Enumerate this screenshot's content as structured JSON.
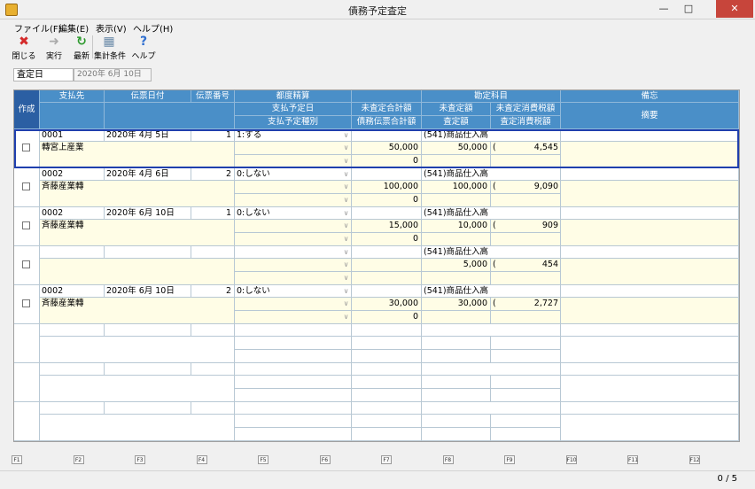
{
  "window": {
    "title": "債務予定査定",
    "min": "—",
    "max": "□",
    "close": "✕"
  },
  "menu": [
    "ファイル(F)",
    "編集(E)",
    "表示(V)",
    "ヘルプ(H)"
  ],
  "toolbar": [
    {
      "name": "close",
      "label": "閉じる",
      "icon": "✖",
      "color": "#d42a2a"
    },
    {
      "name": "run",
      "label": "実行",
      "icon": "➜",
      "color": "#aaaaaa"
    },
    {
      "name": "refresh",
      "label": "最新",
      "icon": "↻",
      "color": "#2e9a2e"
    },
    {
      "name": "conditions",
      "label": "集計条件",
      "icon": "▦",
      "color": "#6a8aa8"
    },
    {
      "name": "help",
      "label": "ヘルプ",
      "icon": "?",
      "color": "#2f6fd0"
    }
  ],
  "filter": {
    "label": "査定日",
    "value": "2020年 6月 10日"
  },
  "headers": {
    "create": "作成",
    "payee": "支払先",
    "slip_date": "伝票日付",
    "slip_no": "伝票番号",
    "each_settle": "都度精算",
    "pay_date": "支払予定日",
    "pay_type": "支払予定種別",
    "unassessed_total": "未査定合計額",
    "debt_slip_total": "債務伝票合計額",
    "account": "勘定科目",
    "unassessed_amount": "未査定額",
    "unassessed_tax": "未査定消費税額",
    "assessed_amount": "査定額",
    "assessed_tax": "査定消費税額",
    "memo": "備忘",
    "summary": "摘要"
  },
  "rows": [
    {
      "code": "0001",
      "name": "轉宮上産業",
      "date": "2020年 4月 5日",
      "no": "1",
      "settle": "1:する",
      "unassessed_total": "50,000",
      "debt_total": "0",
      "account": "(541)商品仕入高",
      "amount": "50,000",
      "paren": "(",
      "tax": "4,545"
    },
    {
      "code": "0002",
      "name": "斉藤産業轉",
      "date": "2020年 4月 6日",
      "no": "2",
      "settle": "0:しない",
      "unassessed_total": "100,000",
      "debt_total": "0",
      "account": "(541)商品仕入高",
      "amount": "100,000",
      "paren": "(",
      "tax": "9,090"
    },
    {
      "code": "0002",
      "name": "斉藤産業轉",
      "date": "2020年 6月 10日",
      "no": "1",
      "settle": "0:しない",
      "unassessed_total": "15,000",
      "debt_total": "0",
      "account": "(541)商品仕入高",
      "amount": "10,000",
      "paren": "(",
      "tax": "909"
    },
    {
      "code": "",
      "name": "",
      "date": "",
      "no": "",
      "settle": "",
      "unassessed_total": "",
      "debt_total": "",
      "account": "(541)商品仕入高",
      "amount": "5,000",
      "paren": "(",
      "tax": "454"
    },
    {
      "code": "0002",
      "name": "斉藤産業轉",
      "date": "2020年 6月 10日",
      "no": "2",
      "settle": "0:しない",
      "unassessed_total": "30,000",
      "debt_total": "0",
      "account": "(541)商品仕入高",
      "amount": "30,000",
      "paren": "(",
      "tax": "2,727"
    }
  ],
  "fkeys": [
    "F1",
    "F2",
    "F3",
    "F4",
    "F5",
    "F6",
    "F7",
    "F8",
    "F9",
    "F10",
    "F11",
    "F12"
  ],
  "status": {
    "pager": "0 / 5"
  }
}
